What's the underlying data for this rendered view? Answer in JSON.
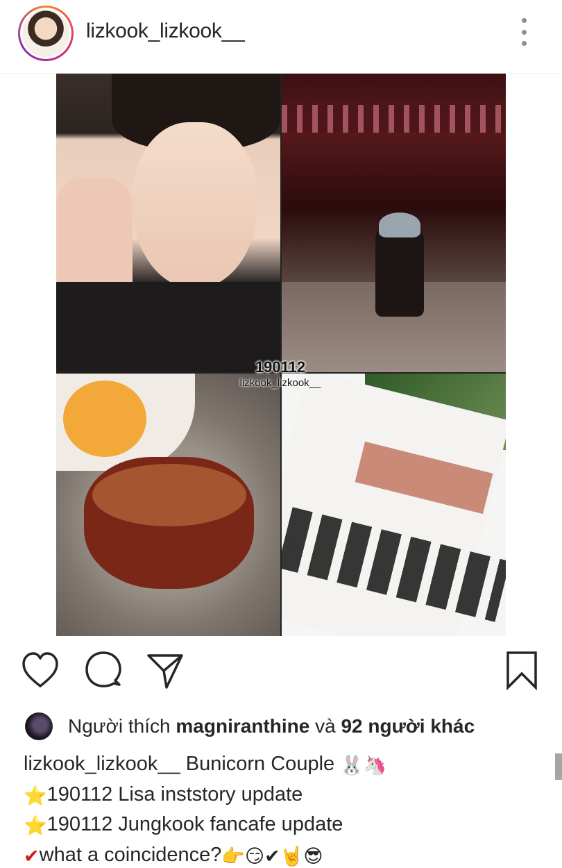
{
  "post": {
    "username": "lizkook_lizkook__",
    "collage": {
      "watermark_date": "190112",
      "watermark_user": "lizkook_lizkook__"
    },
    "actions": {
      "like_icon": "heart-icon",
      "comment_icon": "comment-icon",
      "share_icon": "paper-plane-icon",
      "save_icon": "bookmark-icon"
    },
    "likes": {
      "prefix": "Người thích ",
      "user": "magniranthine",
      "conj": " và ",
      "others": "92 người khác"
    },
    "caption": {
      "line1_user": "lizkook_lizkook__",
      "line1_text": " Bunicorn Couple ",
      "line1_emojis": "🐰🦄",
      "line2_icon": "⭐",
      "line2_text": "190112 Lisa inststory update",
      "line3_icon": "⭐",
      "line3_text": "190112 Jungkook fancafe update",
      "line4_icon": "✔",
      "line4_text": "what a coincidence?",
      "line4_emojis": "👉😏✔🤘😎"
    }
  }
}
